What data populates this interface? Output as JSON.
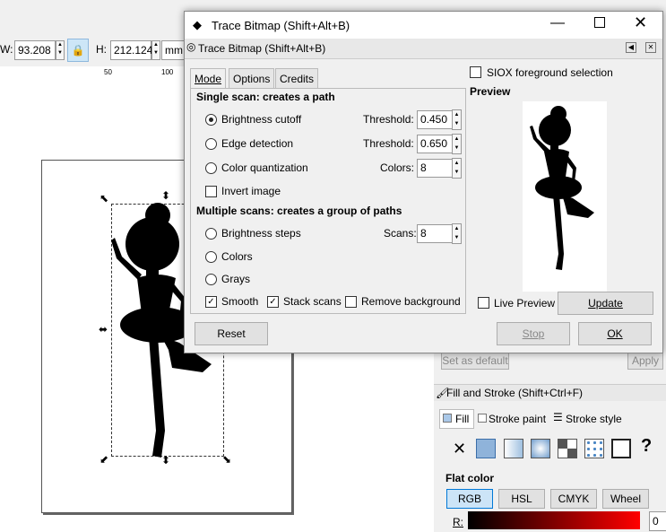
{
  "toolbar": {
    "w_label": "W:",
    "w_value": "93.208",
    "h_label": "H:",
    "h_value": "212.124",
    "unit": "mm"
  },
  "ruler": {
    "ticks": [
      "50",
      "100"
    ]
  },
  "right_panel": {
    "set_default": "Set as default",
    "apply": "Apply",
    "fill_stroke_title": "Fill and Stroke (Shift+Ctrl+F)",
    "tabs": [
      "Fill",
      "Stroke paint",
      "Stroke style"
    ],
    "flat_color": "Flat color",
    "color_modes": [
      "RGB",
      "HSL",
      "CMYK",
      "Wheel"
    ],
    "r_label": "R:",
    "r_value": "0"
  },
  "dialog": {
    "title": "Trace Bitmap (Shift+Alt+B)",
    "subtitle": "Trace Bitmap (Shift+Alt+B)",
    "tabs": [
      "Mode",
      "Options",
      "Credits"
    ],
    "single_scan_heading": "Single scan: creates a path",
    "brightness_cutoff": "Brightness cutoff",
    "edge_detection": "Edge detection",
    "color_quantization": "Color quantization",
    "invert_image": "Invert image",
    "threshold_label": "Threshold:",
    "threshold1": "0.450",
    "threshold2": "0.650",
    "colors_label": "Colors:",
    "colors_value": "8",
    "multiple_scans_heading": "Multiple scans: creates a group of paths",
    "brightness_steps": "Brightness steps",
    "scans_label": "Scans:",
    "scans_value": "8",
    "colors_option": "Colors",
    "grays_option": "Grays",
    "smooth": "Smooth",
    "stack_scans": "Stack scans",
    "remove_background": "Remove background",
    "siox": "SIOX foreground selection",
    "preview_heading": "Preview",
    "live_preview": "Live Preview",
    "update": "Update",
    "reset": "Reset",
    "stop": "Stop",
    "ok": "OK"
  }
}
